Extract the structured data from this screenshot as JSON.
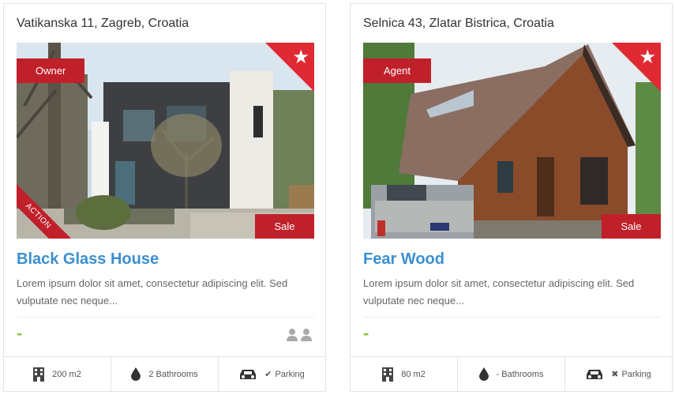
{
  "listings": [
    {
      "address": "Vatikanska 11, Zagreb, Croatia",
      "type_badge": "Owner",
      "sale_badge": "Sale",
      "ribbon": "ACTION",
      "title": "Black Glass House",
      "description": "Lorem ipsum dolor sit amet, consectetur adipiscing elit. Sed vulputate nec neque...",
      "price": "-",
      "area": "200 m2",
      "bathrooms": "2 Bathrooms",
      "parking_mark": "✔",
      "parking": "Parking"
    },
    {
      "address": "Selnica 43, Zlatar Bistrica, Croatia",
      "type_badge": "Agent",
      "sale_badge": "Sale",
      "title": "Fear Wood",
      "description": "Lorem ipsum dolor sit amet, consectetur adipiscing elit. Sed vulputate nec neque...",
      "price": "-",
      "area": "80 m2",
      "bathrooms": "- Bathrooms",
      "parking_mark": "✖",
      "parking": "Parking"
    }
  ],
  "icons": {
    "featured": "star-icon",
    "area": "building-icon",
    "bathrooms": "water-drop-icon",
    "parking": "car-icon",
    "agents": "users-icon"
  },
  "colors": {
    "badge_red": "#c0202a",
    "title_blue": "#3a8fd0",
    "price_green": "#8cc63f"
  }
}
